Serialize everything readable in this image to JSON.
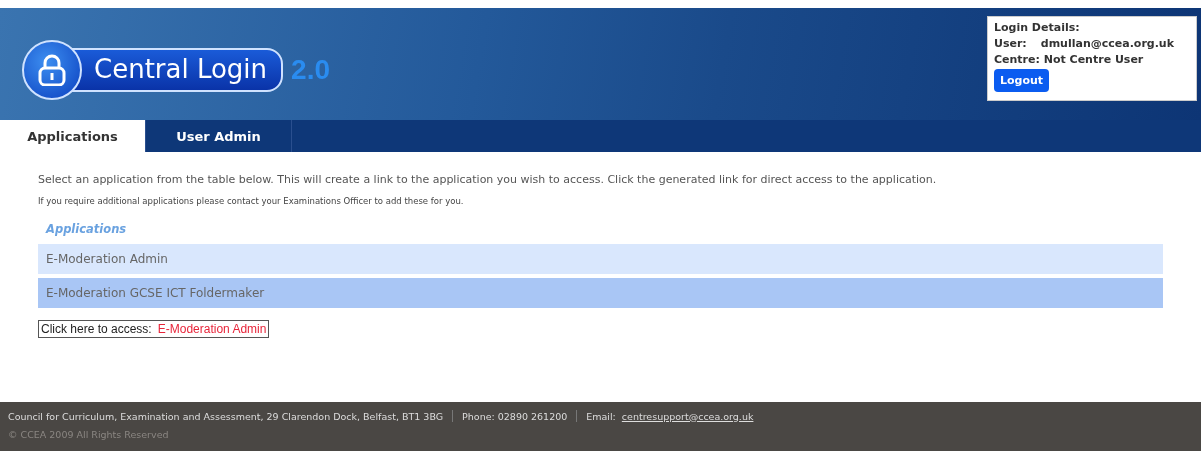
{
  "header": {
    "logo_text": "Central Login",
    "version": "2.0"
  },
  "login_details": {
    "title": "Login Details:",
    "user_label": "User:",
    "user": "dmullan@ccea.org.uk",
    "centre": "Centre: Not Centre User",
    "logout": "Logout"
  },
  "tabs": [
    {
      "label": "Applications",
      "selected": true
    },
    {
      "label": "User Admin",
      "selected": false
    }
  ],
  "intro": "Select an application from the table below. This will create a link to the application you wish to access. Click the generated link for direct access to the application.",
  "note": "If you require additional applications please contact your Examinations Officer to add these for you.",
  "table": {
    "heading": "Applications",
    "rows": [
      {
        "name": "E-Moderation Admin",
        "selected": false
      },
      {
        "name": "E-Moderation GCSE ICT Foldermaker",
        "selected": true
      }
    ]
  },
  "access": {
    "label": "Click here to access:",
    "link": "E-Moderation Admin"
  },
  "footer": {
    "address": "Council for Curriculum, Examination and Assessment,  29 Clarendon Dock, Belfast, BT1 3BG",
    "phone": "Phone:  02890 261200",
    "email_label": "Email:",
    "email": "centresupport@ccea.org.uk",
    "copyright": "© CCEA 2009 All Rights Reserved"
  }
}
